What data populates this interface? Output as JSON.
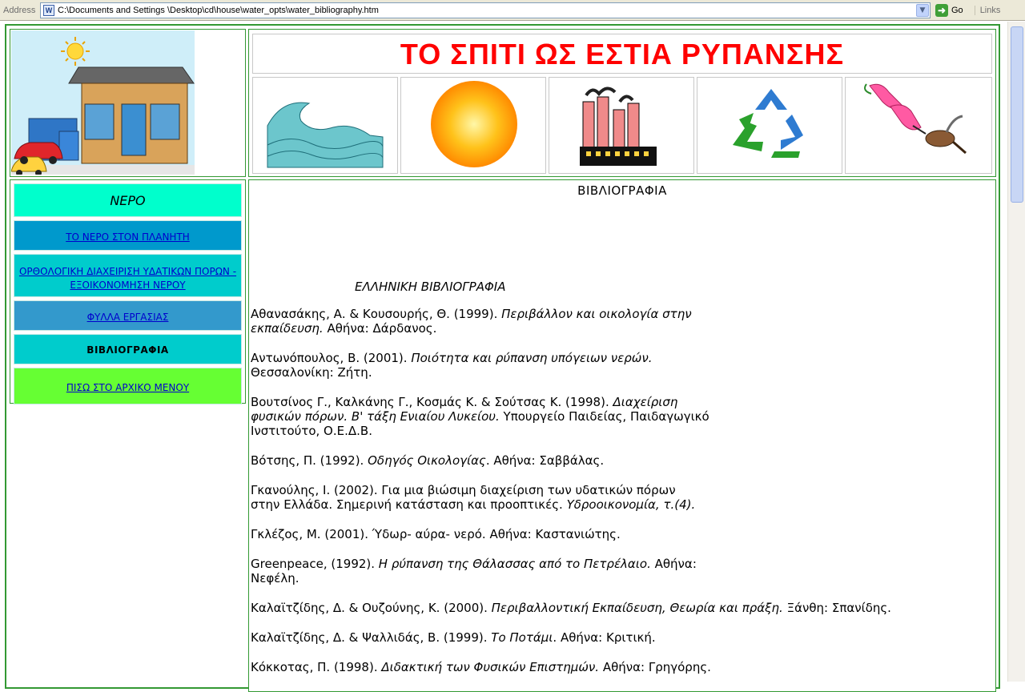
{
  "browser": {
    "address_label": "Address",
    "url": "C:\\Documents and Settings \\Desktop\\cd\\house\\water_opts\\water_bibliography.htm",
    "go_label": "Go",
    "links_label": "Links"
  },
  "banner": {
    "title": "ΤΟ ΣΠΙΤΙ ΩΣ ΕΣΤΙΑ ΡΥΠΑΝΣΗΣ",
    "title_color": "#ff0000",
    "icons": [
      "wave-icon",
      "sun-icon",
      "factory-icon",
      "recycle-icon",
      "flower-bird-icon"
    ]
  },
  "nav": {
    "heading": "ΝΕΡΟ",
    "items": [
      {
        "label": "ΤΟ ΝΕΡΟ ΣΤΟΝ ΠΛΑΝΗΤΗ",
        "bg": "#0099cc"
      },
      {
        "label": "ΟΡΘΟΛΟΓΙΚΗ ΔΙΑΧΕΙΡΙΣΗ ΥΔΑΤΙΚΩΝ ΠΟΡΩΝ - ΕΞΟΙΚΟΝΟΜΗΣΗ ΝΕΡΟΥ",
        "bg": "#00cccc"
      },
      {
        "label": "ΦΥΛΛΑ ΕΡΓΑΣΙΑΣ",
        "bg": "#3399cc"
      },
      {
        "label": "ΒΙΒΛΙΟΓΡΑΦΙΑ",
        "bg": "#00cccc"
      },
      {
        "label": "ΠΙΣΩ ΣΤΟ ΑΡΧΙΚΟ ΜΕΝΟΥ",
        "bg": "#66ff33"
      }
    ]
  },
  "content": {
    "title": "ΒΙΒΛΙΟΓΡΑΦΙΑ",
    "section": "ΕΛΛΗΝΙΚΗ ΒΙΒΛΙΟΓΡΑΦΙΑ",
    "refs": [
      {
        "a": "Αθανασάκης, Α. & Κουσουρής, Θ. (1999). ",
        "i": "Περιβάλλον και οικολογία στην",
        "b": "",
        "i2": "εκπαίδευση.",
        "c": " Αθήνα: Δάρδανος."
      },
      {
        "a": "Αντωνόπουλος, Β. (2001). ",
        "i": "Ποιότητα  και  ρύπανση υπόγειων νερών.",
        "b": "",
        "i2": "",
        "c": "Θεσσαλονίκη: Ζήτη."
      },
      {
        "a": "Βουτσίνος Γ., Καλκάνης Γ., Κοσμάς Κ. & Σούτσας Κ. (1998). ",
        "i": "Διαχείριση",
        "b": "",
        "i2": "φυσικών πόρων. Β' τάξη Ενιαίου Λυκείου.",
        "c": " Υπουργείο Παιδείας, Παιδαγωγικό Ινστιτούτο, Ο.Ε.Δ.Β."
      },
      {
        "a": "Βότσης, Π. (1992). ",
        "i": "Οδηγός Οικολογίας",
        "b": ". Αθήνα: Σαββάλας.",
        "i2": "",
        "c": ""
      },
      {
        "a": "Γκανούλης, Ι. (2002). Για μια βιώσιμη διαχείριση των υδατικών πόρων",
        "i": "",
        "b": "",
        "i2": "",
        "c": "στην Ελλάδα. Σημερινή κατάσταση και προοπτικές. ",
        "i3": "Υδροοικονομία, τ.(4)."
      },
      {
        "a": "Γκλέζος, Μ. (2001). Ύδωρ- αύρα- νερό. Αθήνα: Καστανιώτης.",
        "i": "",
        "b": "",
        "i2": "",
        "c": ""
      },
      {
        "a": "Greenpeace, (1992). ",
        "i": "Η ρύπανση της Θάλασσας από το Πετρέλαιο.",
        "b": " Αθήνα:",
        "i2": "",
        "c": "Νεφέλη."
      },
      {
        "a": "Καλαϊτζίδης, Δ. & Ουζούνης, Κ. (2000). ",
        "i": "Περιβαλλοντική Εκπαίδευση, Θεωρία και πράξη.",
        "b": " Ξάνθη: Σπανίδης.",
        "i2": "",
        "c": ""
      },
      {
        "a": "Καλαϊτζίδης, Δ. & Ψαλλιδάς, Β. (1999). ",
        "i": "Το Ποτάμι",
        "b": ". Αθήνα: Κριτική.",
        "i2": "",
        "c": ""
      },
      {
        "a": "Κόκκοτας, Π. (1998). ",
        "i": "Διδακτική των Φυσικών Επιστημών.",
        "b": " Αθήνα: Γρηγόρης.",
        "i2": "",
        "c": ""
      }
    ]
  }
}
